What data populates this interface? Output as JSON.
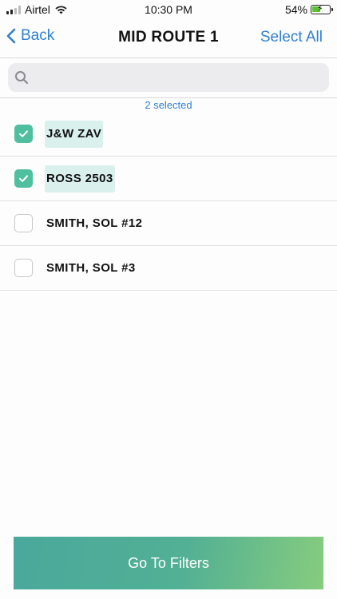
{
  "status_bar": {
    "carrier": "Airtel",
    "time": "10:30 PM",
    "battery_percent": "54%",
    "battery_level": 0.54
  },
  "nav": {
    "back_label": "Back",
    "title": "MID ROUTE 1",
    "select_all_label": "Select All"
  },
  "search": {
    "placeholder": "",
    "value": ""
  },
  "selected_count": "2 selected",
  "items": [
    {
      "label": "J&W ZAV",
      "checked": true
    },
    {
      "label": "ROSS 2503",
      "checked": true
    },
    {
      "label": "SMITH, SOL #12",
      "checked": false
    },
    {
      "label": "SMITH, SOL #3",
      "checked": false
    }
  ],
  "footer": {
    "button_label": "Go To Filters"
  },
  "colors": {
    "accent_blue": "#2f80d1",
    "check_green": "#4fbf9f",
    "highlight": "#d9f0ec",
    "button_gradient_start": "#4aa89c",
    "button_gradient_end": "#86cc7e"
  }
}
